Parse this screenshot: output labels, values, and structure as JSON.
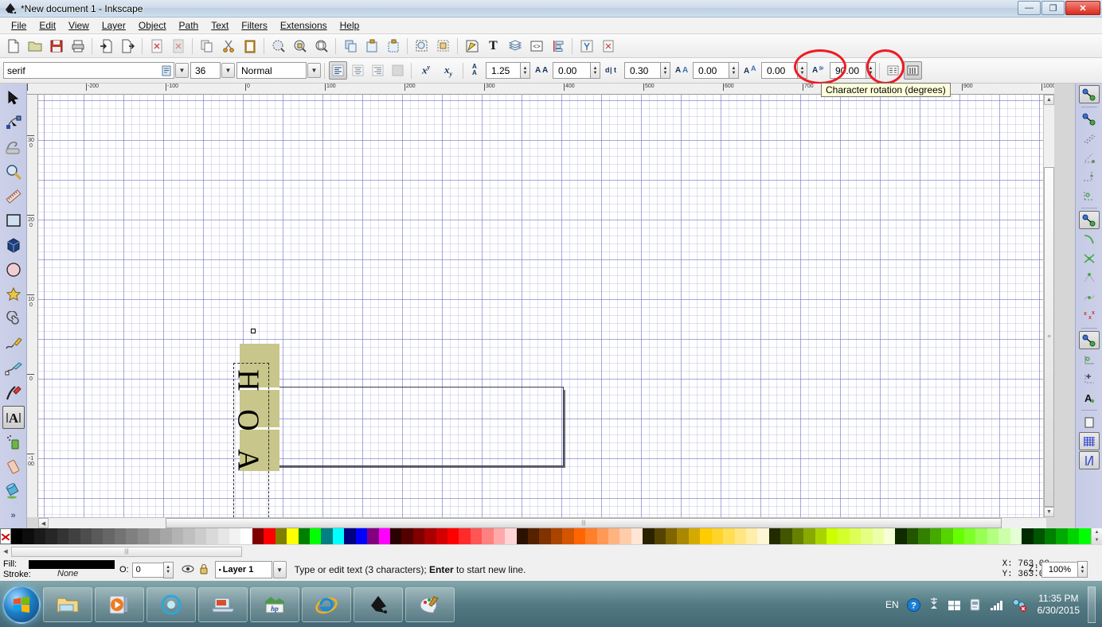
{
  "window": {
    "title": "*New document 1 - Inkscape",
    "app_icon": "inkscape-icon",
    "buttons": {
      "minimize": "—",
      "maximize": "❐",
      "close": "✕"
    }
  },
  "menubar": {
    "items": [
      {
        "label": "File",
        "mnemonic": "F"
      },
      {
        "label": "Edit",
        "mnemonic": "E"
      },
      {
        "label": "View",
        "mnemonic": "V"
      },
      {
        "label": "Layer",
        "mnemonic": "L"
      },
      {
        "label": "Object",
        "mnemonic": "O"
      },
      {
        "label": "Path",
        "mnemonic": "P"
      },
      {
        "label": "Text",
        "mnemonic": "T"
      },
      {
        "label": "Filters",
        "mnemonic": "r"
      },
      {
        "label": "Extensions",
        "mnemonic": "n"
      },
      {
        "label": "Help",
        "mnemonic": "H"
      }
    ]
  },
  "commandbar": {
    "buttons": [
      "new-document-icon",
      "open-document-icon",
      "save-document-icon",
      "print-document-icon",
      "import-icon",
      "export-icon",
      "undo-icon",
      "redo-icon",
      "copy-icon",
      "cut-icon",
      "paste-icon",
      "zoom-selection-icon",
      "zoom-drawing-icon",
      "zoom-page-icon",
      "duplicate-icon",
      "group-icon",
      "ungroup-icon",
      "fill-stroke-dialog-icon",
      "edit-objects-icon",
      "text-properties-icon",
      "text-tool-icon",
      "layers-dialog-icon",
      "xml-editor-icon",
      "align-distribute-icon",
      "preferences-icon",
      "document-properties-icon"
    ]
  },
  "textbar": {
    "font_family": "serif",
    "font_family_icon": "font-list-icon",
    "font_size": "36",
    "font_style": "Normal",
    "align_buttons": [
      {
        "name": "align-left",
        "icon": "align-left-icon",
        "active": true
      },
      {
        "name": "align-center",
        "icon": "align-center-icon",
        "active": false
      },
      {
        "name": "align-right",
        "icon": "align-right-icon",
        "active": false
      },
      {
        "name": "align-justify",
        "icon": "align-justify-icon",
        "active": false
      }
    ],
    "superscript_label": "x",
    "superscript_sup": "y",
    "subscript_label": "x",
    "subscript_sub": "y",
    "fields": [
      {
        "name": "line-spacing",
        "icon": "line-spacing-icon",
        "value": "1.25",
        "width": 44
      },
      {
        "name": "letter-spacing",
        "icon": "letter-spacing-icon",
        "value": "0.00",
        "width": 48
      },
      {
        "name": "word-spacing",
        "icon": "word-spacing-icon",
        "value": "0.30",
        "width": 46
      },
      {
        "name": "horizontal-kerning",
        "icon": "horizontal-kerning-icon",
        "value": "0.00",
        "width": 46
      },
      {
        "name": "vertical-kerning",
        "icon": "vertical-kerning-icon",
        "value": "0.00",
        "width": 46
      },
      {
        "name": "character-rotation",
        "icon": "character-rotation-icon",
        "value": "90.00",
        "width": 46
      }
    ],
    "writing_mode_horizontal": "horizontal-text-icon",
    "writing_mode_vertical": "vertical-text-icon"
  },
  "tooltip": {
    "text": "Character rotation (degrees)"
  },
  "annotations": {
    "circle_color": "#ee1c23",
    "targets": [
      "character-rotation-field",
      "vertical-text-button"
    ]
  },
  "toolbox": {
    "tools": [
      {
        "name": "selector-tool",
        "icon": "arrow-pointer-icon",
        "active": false
      },
      {
        "name": "node-tool",
        "icon": "node-edit-icon",
        "active": false
      },
      {
        "name": "tweak-tool",
        "icon": "tweak-icon",
        "active": false
      },
      {
        "name": "zoom-tool",
        "icon": "magnifier-icon",
        "active": false
      },
      {
        "name": "measure-tool",
        "icon": "ruler-icon",
        "active": false
      },
      {
        "name": "rectangle-tool",
        "icon": "rectangle-icon",
        "active": false
      },
      {
        "name": "box3d-tool",
        "icon": "cube-icon",
        "active": false
      },
      {
        "name": "ellipse-tool",
        "icon": "ellipse-icon",
        "active": false
      },
      {
        "name": "star-tool",
        "icon": "star-icon",
        "active": false
      },
      {
        "name": "spiral-tool",
        "icon": "spiral-icon",
        "active": false
      },
      {
        "name": "pencil-tool",
        "icon": "pencil-icon",
        "active": false
      },
      {
        "name": "pen-tool",
        "icon": "bezier-pen-icon",
        "active": false
      },
      {
        "name": "calligraphy-tool",
        "icon": "calligraphy-icon",
        "active": false
      },
      {
        "name": "text-tool",
        "icon": "text-A-icon",
        "active": true
      },
      {
        "name": "spray-tool",
        "icon": "spray-can-icon",
        "active": false
      },
      {
        "name": "eraser-tool",
        "icon": "eraser-icon",
        "active": false
      },
      {
        "name": "paint-bucket-tool",
        "icon": "paint-bucket-icon",
        "active": false
      }
    ],
    "overflow_label": "»"
  },
  "snapbar": {
    "buttons": [
      {
        "name": "enable-snapping",
        "icon": "snap-master-icon",
        "active": true,
        "sep_after": true
      },
      {
        "name": "snap-bounding-boxes",
        "icon": "snap-bbox-icon",
        "active": false
      },
      {
        "name": "snap-bbox-edges",
        "icon": "snap-bbox-edge-icon",
        "active": false
      },
      {
        "name": "snap-bbox-corners",
        "icon": "snap-bbox-corner-icon",
        "active": false
      },
      {
        "name": "snap-bbox-edge-midpoints",
        "icon": "snap-bbox-midpoint-icon",
        "active": false
      },
      {
        "name": "snap-bbox-centers",
        "icon": "snap-bbox-center-icon",
        "active": false,
        "sep_after": true
      },
      {
        "name": "snap-nodes-paths",
        "icon": "snap-nodes-icon",
        "active": true
      },
      {
        "name": "snap-paths",
        "icon": "snap-path-icon",
        "active": false
      },
      {
        "name": "snap-path-intersections",
        "icon": "snap-intersection-icon",
        "active": false
      },
      {
        "name": "snap-to-cusp-nodes",
        "icon": "snap-cusp-icon",
        "active": false
      },
      {
        "name": "snap-smooth-nodes",
        "icon": "snap-smooth-icon",
        "active": false
      },
      {
        "name": "snap-midpoints",
        "icon": "snap-midpoint-icon",
        "active": false,
        "sep_after": true
      },
      {
        "name": "snap-others",
        "icon": "snap-others-icon",
        "active": true
      },
      {
        "name": "snap-object-centers",
        "icon": "snap-object-center-icon",
        "active": false
      },
      {
        "name": "snap-rotation-centers",
        "icon": "snap-rotation-center-icon",
        "active": false
      },
      {
        "name": "snap-text-baselines",
        "icon": "snap-text-baseline-icon",
        "active": false,
        "sep_after": true
      },
      {
        "name": "snap-page-border",
        "icon": "snap-page-border-icon",
        "active": false
      },
      {
        "name": "snap-grids",
        "icon": "snap-grid-icon",
        "active": true
      },
      {
        "name": "snap-guides",
        "icon": "snap-guide-icon",
        "active": true
      }
    ]
  },
  "rulers": {
    "unit": "px",
    "h_labels": [
      "-200",
      "-100",
      "0",
      "100",
      "200",
      "300",
      "400",
      "500",
      "600",
      "700",
      "800",
      "900",
      "1000"
    ],
    "v_labels": [
      "300",
      "200",
      "100",
      "0",
      "-100"
    ]
  },
  "canvas": {
    "text_object": {
      "characters": [
        "H",
        "O",
        "A"
      ],
      "character_count": "3",
      "rotation_degrees": "90",
      "highlight_color": "#c8c68a"
    },
    "page_border": true,
    "grid_visible": true
  },
  "palette": {
    "none_swatch": "none-color-icon",
    "colors": [
      "#000000",
      "#0d0d0d",
      "#1a1a1a",
      "#262626",
      "#333333",
      "#404040",
      "#4d4d4d",
      "#5a5a5a",
      "#666666",
      "#737373",
      "#808080",
      "#8c8c8c",
      "#999999",
      "#a6a6a6",
      "#b3b3b3",
      "#bfbfbf",
      "#cccccc",
      "#d9d9d9",
      "#e6e6e6",
      "#f2f2f2",
      "#ffffff",
      "#800000",
      "#ff0000",
      "#808000",
      "#ffff00",
      "#008000",
      "#00ff00",
      "#008080",
      "#00ffff",
      "#000080",
      "#0000ff",
      "#800080",
      "#ff00ff",
      "#2b0000",
      "#550000",
      "#800000",
      "#aa0000",
      "#d40000",
      "#ff0000",
      "#ff2a2a",
      "#ff5555",
      "#ff8080",
      "#ffaaaa",
      "#ffd5d5",
      "#2b1100",
      "#552200",
      "#803300",
      "#aa4400",
      "#d45500",
      "#ff6600",
      "#ff7f2a",
      "#ff9955",
      "#ffb380",
      "#ffccaa",
      "#ffe6d5",
      "#2b2200",
      "#554400",
      "#806600",
      "#aa8800",
      "#d4aa00",
      "#ffcc00",
      "#ffd42a",
      "#ffdd55",
      "#ffe680",
      "#ffeeaa",
      "#fff6d5",
      "#222b00",
      "#445500",
      "#668000",
      "#88aa00",
      "#aad400",
      "#ccff00",
      "#d4ff2a",
      "#ddff55",
      "#e5ff80",
      "#eeffaa",
      "#f6ffd5",
      "#112b00",
      "#225500",
      "#338000",
      "#44aa00",
      "#55d400",
      "#66ff00",
      "#7fff2a",
      "#99ff55",
      "#b3ff80",
      "#ccffaa",
      "#e5ffd5",
      "#002b00",
      "#005500",
      "#008000",
      "#00aa00",
      "#00d400",
      "#00ff00"
    ],
    "scroll_icon": "palette-scroll-icon"
  },
  "statusbar": {
    "fill_label": "Fill:",
    "stroke_label": "Stroke:",
    "fill_value": "#000000",
    "stroke_value": "None",
    "opacity_label": "O:",
    "opacity_value": "0",
    "visibility_icon": "eye-icon",
    "lock_icon": "lock-icon",
    "layer_name": "Layer 1",
    "message_before": "Type or edit text (3 characters); ",
    "message_bold": "Enter",
    "message_after": " to start new line.",
    "x_label": "X:",
    "x_value": "763.00",
    "y_label": "Y:",
    "y_value": "363.00",
    "zoom_label": "Z:",
    "zoom_value": "100%"
  },
  "taskbar": {
    "start_icon": "windows-start-orb-icon",
    "apps": [
      {
        "name": "windows-explorer",
        "icon": "folder-icon"
      },
      {
        "name": "windows-media-player",
        "icon": "media-player-icon"
      },
      {
        "name": "media-center",
        "icon": "orb-icon"
      },
      {
        "name": "laptop-support",
        "icon": "laptop-icon"
      },
      {
        "name": "hp-support-assistant",
        "icon": "hp-icon"
      },
      {
        "name": "internet-explorer",
        "icon": "ie-icon"
      },
      {
        "name": "inkscape",
        "icon": "inkscape-icon"
      },
      {
        "name": "paint",
        "icon": "paint-palette-icon"
      }
    ],
    "tray": {
      "language": "EN",
      "items": [
        "help-icon",
        "show-hidden-icons-icon",
        "action-center-icon",
        "removable-media-icon",
        "network-icon",
        "network-error-icon"
      ],
      "time": "11:35 PM",
      "date": "6/30/2015"
    }
  }
}
